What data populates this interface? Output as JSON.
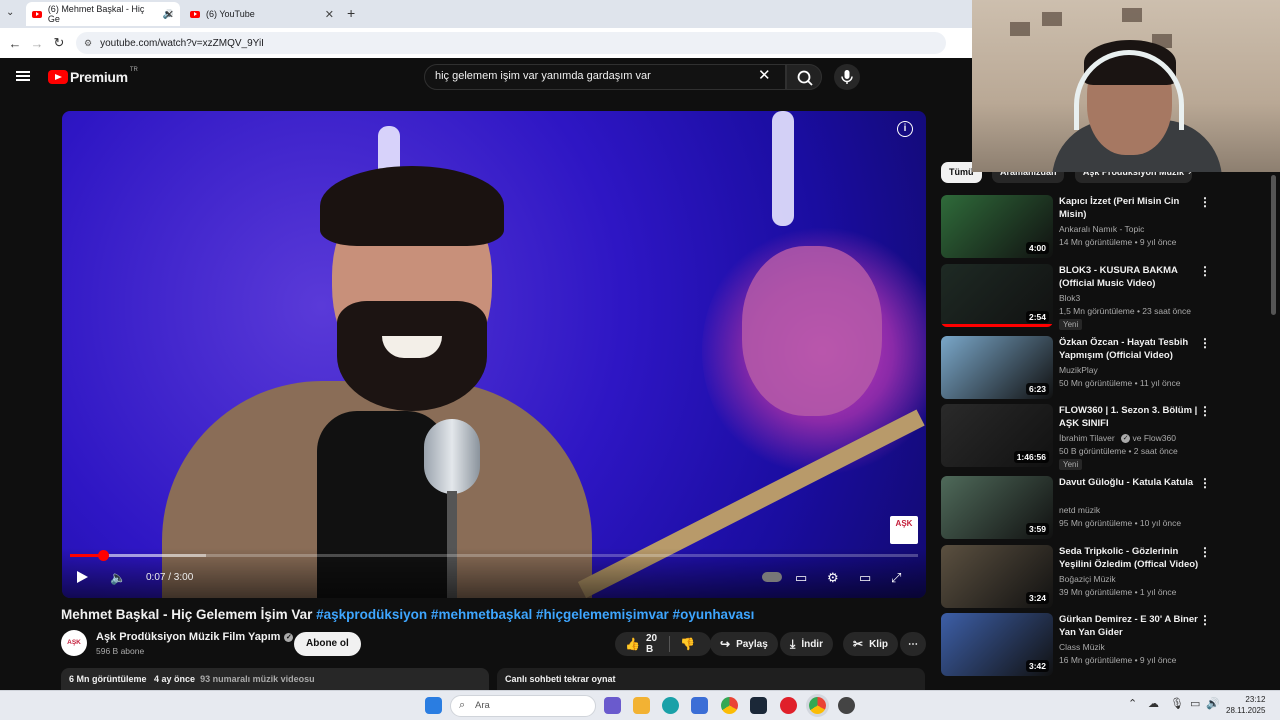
{
  "browser": {
    "tabs": [
      {
        "label": "(6) Mehmet Başkal - Hiç Ge",
        "active": true
      },
      {
        "label": "(6) YouTube",
        "active": false
      }
    ],
    "url": "youtube.com/watch?v=xzZMQV_9YiI"
  },
  "header": {
    "logo_text": "Premium",
    "logo_region": "TR",
    "search_value": "hiç gelemem işim var yanımda gardaşım var"
  },
  "player": {
    "time_display": "0:07 / 3:00",
    "progress_fraction": 0.039,
    "buffered_fraction": 0.16,
    "watermark": "AŞK"
  },
  "video": {
    "title_main": "Mehmet Başkal - Hiç Gelemem İşim Var",
    "title_tags": "#aşkprodüksiyon #mehmetbaşkal #hiçgelememişimvar #oyunhavası",
    "channel_name": "Aşk Prodüksiyon Müzik Film Yapım",
    "channel_avatar_text": "AŞK",
    "subscribers": "596 B abone",
    "subscribe_label": "Abone ol",
    "likes": "20 B",
    "share_label": "Paylaş",
    "download_label": "İndir",
    "clip_label": "Klip",
    "views": "6 Mn görüntüleme",
    "age": "4 ay önce",
    "rank": "93 numaralı müzik videosu",
    "chat_replay": "Canlı sohbeti tekrar oynat"
  },
  "chips": [
    "Tümü",
    "Aramanızdan",
    "Aşk Prodüksiyon Müzik"
  ],
  "recommendations": [
    {
      "title": "Kapıcı İzzet (Peri Misin Cin Misin)",
      "channel": "Ankaralı Namık - Topic",
      "meta": "14 Mn görüntüleme • 9 yıl önce",
      "duration": "4:00",
      "thumb": "#2f6b3a"
    },
    {
      "title": "BLOK3 - KUSURA BAKMA (Official Music Video)",
      "channel": "Blok3",
      "meta": "1,5 Mn görüntüleme • 23 saat önce",
      "badge": "Yeni",
      "duration": "2:54",
      "thumb": "#1e2a24",
      "watched_fraction": 1.0
    },
    {
      "title": "Özkan Özcan - Hayatı Tesbih Yapmışım (Official Video)",
      "channel": "MuzikPlay",
      "meta": "50 Mn görüntüleme • 11 yıl önce",
      "duration": "6:23",
      "thumb": "#7aa7c9"
    },
    {
      "title": "FLOW360 | 1. Sezon 3. Bölüm | AŞK SINIFI",
      "channel": "İbrahim Tilaver",
      "channel_extra": "ve Flow360",
      "meta": "50 B görüntüleme • 2 saat önce",
      "badge": "Yeni",
      "duration": "1:46:56",
      "thumb": "#2a2a2a"
    },
    {
      "title": "Davut Güloğlu - Katula Katula",
      "channel": "netd müzik",
      "meta": "95 Mn görüntüleme • 10 yıl önce",
      "duration": "3:59",
      "thumb": "#4f6a5a"
    },
    {
      "title": "Seda Tripkolic - Gözlerinin Yeşilini Özledim (Offical Video)",
      "channel": "Boğaziçi Müzik",
      "meta": "39 Mn görüntüleme • 1 yıl önce",
      "duration": "3:24",
      "thumb": "#5b5040"
    },
    {
      "title": "Gürkan Demirez - E 30' A Biner Yan Yan Gider",
      "channel": "Class Müzik",
      "meta": "16 Mn görüntüleme • 9 yıl önce",
      "duration": "3:42",
      "thumb": "#3d5fa8"
    }
  ],
  "taskbar": {
    "search_placeholder": "Ara",
    "time": "23:12",
    "date": "28.11.2025"
  }
}
